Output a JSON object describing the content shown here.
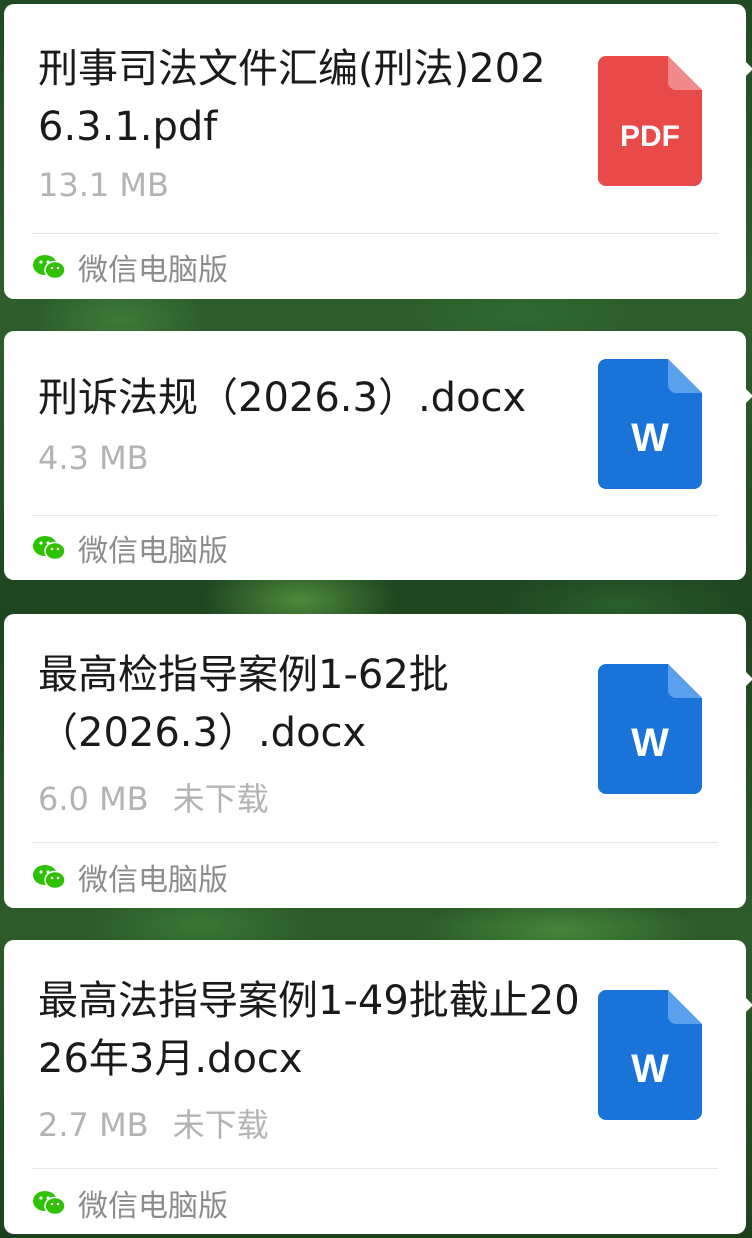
{
  "files": [
    {
      "title": "刑事司法文件汇编(刑法)2026.3.1.pdf",
      "size": "13.1 MB",
      "status": "",
      "icon_type": "pdf",
      "icon_label": "PDF",
      "source": "微信电脑版"
    },
    {
      "title": "刑诉法规（2026.3）.docx",
      "size": "4.3 MB",
      "status": "",
      "icon_type": "word",
      "icon_label": "W",
      "source": "微信电脑版"
    },
    {
      "title": "最高检指导案例1-62批（2026.3）.docx",
      "size": "6.0 MB",
      "status": "未下载",
      "icon_type": "word",
      "icon_label": "W",
      "source": "微信电脑版"
    },
    {
      "title": "最高法指导案例1-49批截止2026年3月.docx",
      "size": "2.7 MB",
      "status": "未下载",
      "icon_type": "word",
      "icon_label": "W",
      "source": "微信电脑版"
    }
  ],
  "colors": {
    "pdf": "#e84a4a",
    "pdf_fold": "#f08a8a",
    "word": "#1a73d9",
    "word_fold": "#5aa0ec",
    "wechat": "#2dc100"
  }
}
